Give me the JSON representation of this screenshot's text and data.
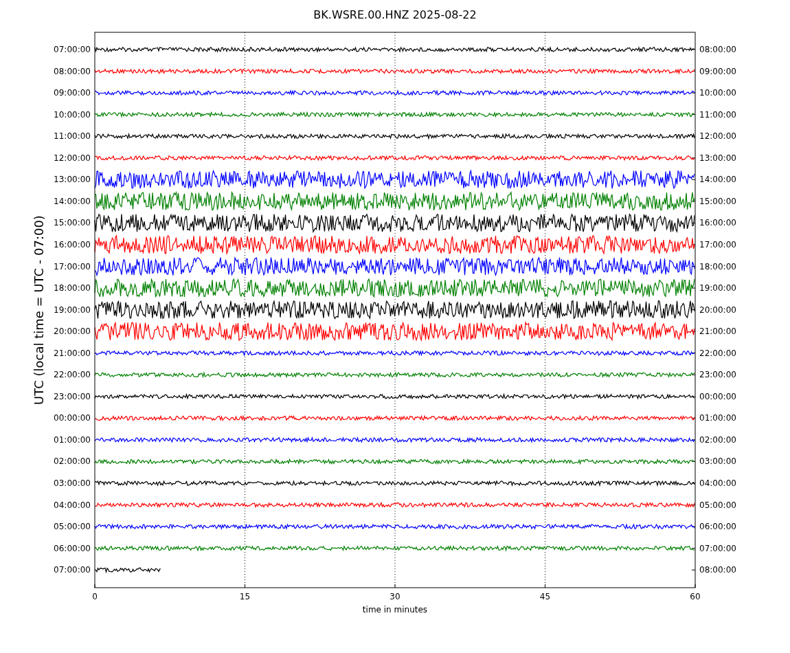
{
  "title": "BK.WSRE.00.HNZ 2025-08-22",
  "ylabel": "UTC (local time = UTC - 07:00)",
  "xlabel": "time in minutes",
  "xticks": [
    "0",
    "15",
    "30",
    "45",
    "60"
  ],
  "traces": [
    {
      "left": "07:00:00",
      "right": "08:00:00",
      "color": "#000000",
      "kind": "quiet"
    },
    {
      "left": "08:00:00",
      "right": "09:00:00",
      "color": "#ff0000",
      "kind": "quiet"
    },
    {
      "left": "09:00:00",
      "right": "10:00:00",
      "color": "#0000ff",
      "kind": "quiet"
    },
    {
      "left": "10:00:00",
      "right": "11:00:00",
      "color": "#008000",
      "kind": "quiet"
    },
    {
      "left": "11:00:00",
      "right": "12:00:00",
      "color": "#000000",
      "kind": "quiet"
    },
    {
      "left": "12:00:00",
      "right": "13:00:00",
      "color": "#ff0000",
      "kind": "quiet"
    },
    {
      "left": "13:00:00",
      "right": "14:00:00",
      "color": "#0000ff",
      "kind": "noisy"
    },
    {
      "left": "14:00:00",
      "right": "15:00:00",
      "color": "#008000",
      "kind": "noisy"
    },
    {
      "left": "15:00:00",
      "right": "16:00:00",
      "color": "#000000",
      "kind": "noisy"
    },
    {
      "left": "16:00:00",
      "right": "17:00:00",
      "color": "#ff0000",
      "kind": "noisy"
    },
    {
      "left": "17:00:00",
      "right": "18:00:00",
      "color": "#0000ff",
      "kind": "noisy"
    },
    {
      "left": "18:00:00",
      "right": "19:00:00",
      "color": "#008000",
      "kind": "noisy"
    },
    {
      "left": "19:00:00",
      "right": "20:00:00",
      "color": "#000000",
      "kind": "noisy"
    },
    {
      "left": "20:00:00",
      "right": "21:00:00",
      "color": "#ff0000",
      "kind": "noisy"
    },
    {
      "left": "21:00:00",
      "right": "22:00:00",
      "color": "#0000ff",
      "kind": "quiet"
    },
    {
      "left": "22:00:00",
      "right": "23:00:00",
      "color": "#008000",
      "kind": "quiet"
    },
    {
      "left": "23:00:00",
      "right": "00:00:00",
      "color": "#000000",
      "kind": "quiet"
    },
    {
      "left": "00:00:00",
      "right": "01:00:00",
      "color": "#ff0000",
      "kind": "quiet"
    },
    {
      "left": "01:00:00",
      "right": "02:00:00",
      "color": "#0000ff",
      "kind": "quiet"
    },
    {
      "left": "02:00:00",
      "right": "03:00:00",
      "color": "#008000",
      "kind": "quiet"
    },
    {
      "left": "03:00:00",
      "right": "04:00:00",
      "color": "#000000",
      "kind": "quiet"
    },
    {
      "left": "04:00:00",
      "right": "05:00:00",
      "color": "#ff0000",
      "kind": "quiet"
    },
    {
      "left": "05:00:00",
      "right": "06:00:00",
      "color": "#0000ff",
      "kind": "quiet"
    },
    {
      "left": "06:00:00",
      "right": "07:00:00",
      "color": "#008000",
      "kind": "quiet"
    },
    {
      "left": "07:00:00",
      "right": "08:00:00",
      "color": "#000000",
      "kind": "partial"
    }
  ]
}
